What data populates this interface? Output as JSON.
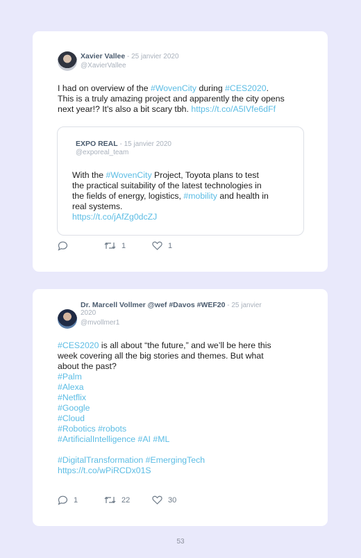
{
  "tweets": [
    {
      "author": "Xavier Vallee",
      "date": " - 25 janvier 2020",
      "handle": "@XavierVallee",
      "body": {
        "p1": "I had on overview of the ",
        "h1": "#WovenCity",
        "p2": " during ",
        "h2": "#CES2020",
        "p3": ".",
        "l2": "This is a truly amazing project and apparently the city opens",
        "l3a": "next year!? It's also a bit scary tbh. ",
        "url": "https://t.co/A5IVfe6dFf"
      },
      "quote": {
        "author": "EXPO REAL",
        "date": " - 15 janvier 2020",
        "handle": "@exporeal_team",
        "l1a": "With the ",
        "l1h": "#WovenCity",
        "l1b": " Project, Toyota plans to test",
        "l2": "the practical suitability of the latest technologies in",
        "l3a": "the fields of energy, logistics, ",
        "l3h": "#mobility",
        "l3b": " and health in",
        "l4": "real systems.",
        "url": "https://t.co/jAfZg0dcZJ"
      },
      "actions": {
        "replies": "",
        "retweets": "1",
        "likes": "1"
      }
    },
    {
      "author": "Dr. Marcell Vollmer @wef #Davos #WEF20",
      "date": " - 25 janvier",
      "date2": "2020",
      "handle": "@mvollmer1",
      "body": {
        "h0": "#CES2020",
        "p1": " is all about “the future,” and we’ll be here this",
        "l2": "week covering all the big stories and themes. But what",
        "l3": "about the past?",
        "tags": [
          "#Palm",
          "#Alexa",
          "#Netflix",
          "#Google",
          "#Cloud",
          "#Robotics #robots",
          "#ArtificialIntelligence #AI #ML"
        ],
        "tags2": "#DigitalTransformation #EmergingTech",
        "url": "https://t.co/wPiRCDx01S"
      },
      "actions": {
        "replies": "1",
        "retweets": "22",
        "likes": "30"
      }
    }
  ],
  "page_number": "53",
  "colors": {
    "link": "#5bbce4",
    "background": "#e9e9fb",
    "card": "#ffffff"
  }
}
